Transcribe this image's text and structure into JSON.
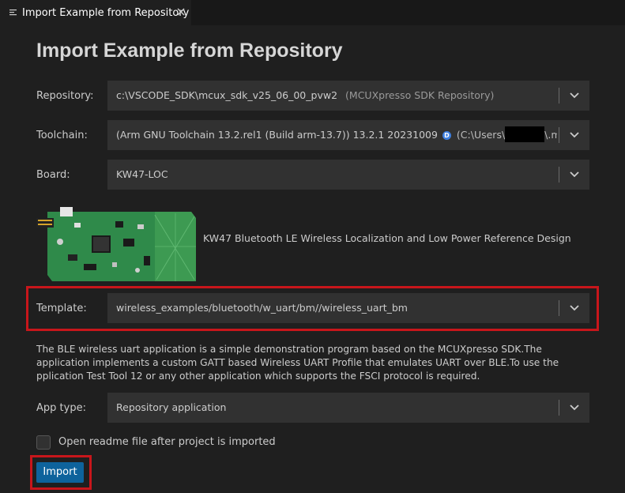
{
  "tab": {
    "title": "Import Example from Repository",
    "icon": "preview-icon",
    "close_icon": "close-icon"
  },
  "page": {
    "title": "Import Example from Repository"
  },
  "repository": {
    "label": "Repository:",
    "value": "c:\\VSCODE_SDK\\mcux_sdk_v25_06_00_pvw2",
    "hint": "(MCUXpresso SDK Repository)"
  },
  "toolchain": {
    "label": "Toolchain:",
    "value": "(Arm GNU Toolchain 13.2.rel1 (Build arm-13.7)) 13.2.1 20231009",
    "badge": "D",
    "path_prefix": "(C:\\Users\\",
    "path_suffix": "\\.mcuxpre"
  },
  "board": {
    "label": "Board:",
    "value": "KW47-LOC",
    "description": "KW47 Bluetooth LE Wireless Localization and Low Power Reference Design"
  },
  "template": {
    "label": "Template:",
    "value": "wireless_examples/bluetooth/w_uart/bm//wireless_uart_bm"
  },
  "description": "The BLE wireless uart application is a simple demonstration program based on the MCUXpresso SDK.The application implements a custom GATT based Wireless UART Profile that emulates UART over BLE.To use the pplication Test Tool 12 or any other application which supports the FSCI protocol is required.",
  "app_type": {
    "label": "App type:",
    "value": "Repository application"
  },
  "readme": {
    "label": "Open readme file after project is imported",
    "checked": false
  },
  "import_button": {
    "label": "Import"
  },
  "colors": {
    "background": "#1f1f1f",
    "select_bg": "#313131",
    "accent_button": "#0e639c",
    "highlight_red": "#c8161b",
    "pcb_green": "#2f8a4a"
  }
}
